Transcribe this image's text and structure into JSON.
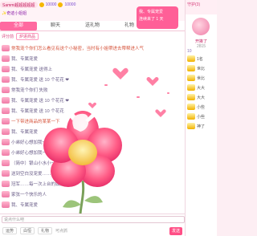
{
  "top": {
    "user_name": "Sammi超超超超超",
    "level": "Lv",
    "coins": "10000",
    "coins2": "10000",
    "note": "✨奇迹小姐姐"
  },
  "popup": {
    "line1": "我、专属宠爱",
    "line2": "连续来了 1 天"
  },
  "tabs": [
    "全部",
    "聊天",
    "送礼物",
    "礼物",
    "活动"
  ],
  "sub": {
    "label": "评分前",
    "chip": "炉进商品"
  },
  "messages": [
    {
      "name": "",
      "text": "常我宠个你们怎么看见有送个小秘密，当时有小姐帶进去帶帮进人气",
      "sys": true
    },
    {
      "name": "",
      "text": "我、专属宠爱",
      "sys": false
    },
    {
      "name": "",
      "text": "我、专属宠爱  送得上",
      "sys": false
    },
    {
      "name": "",
      "text": "我、专属宠爱  送 10 个花花 ❤",
      "sys": false
    },
    {
      "name": "",
      "text": "常我宠个你们 失败",
      "sys": false
    },
    {
      "name": "",
      "text": "我、专属宠爱  送 10 个花花 ❤",
      "sys": false
    },
    {
      "name": "",
      "text": "我、专属宠爱  送 10 个花花",
      "sys": false
    },
    {
      "name": "",
      "text": "一下带进商品的某某一下",
      "sys": true
    },
    {
      "name": "",
      "text": "我、专属宠爱",
      "sys": false
    },
    {
      "name": "",
      "text": "小弟好心想加我一下（侨为）",
      "sys": false
    },
    {
      "name": "",
      "text": "小弟好心想加我一下（红箱）",
      "sys": false
    },
    {
      "name": "",
      "text": "（简中）银山小水小一贺达",
      "sys": false
    },
    {
      "name": "",
      "text": "送到空白没宠爱……",
      "sys": false
    },
    {
      "name": "",
      "text": "冠军……每一次上台的鼓励…",
      "sys": false
    },
    {
      "name": "",
      "text": "家弦一个快乐的人",
      "sys": false
    },
    {
      "name": "",
      "text": "我、专属宠爱",
      "sys": false
    }
  ],
  "input": {
    "placeholder": "说点什么吧",
    "send": "发送"
  },
  "bottom": {
    "btn1": "运势",
    "btn2": "白恒",
    "btn3": "礼物",
    "label": "可点抓"
  },
  "right": {
    "header": "守护(3)",
    "name": "开挨了",
    "num": "2815",
    "rank_label": "10",
    "items": [
      {
        "text": "1名"
      },
      {
        "text": "世比"
      },
      {
        "text": "世比"
      },
      {
        "text": "大大"
      },
      {
        "text": "大大"
      },
      {
        "text": "小些"
      },
      {
        "text": "小些"
      },
      {
        "text": "神了"
      }
    ]
  },
  "colors": {
    "accent": "#ff5f97",
    "tab_active": "#ff6aa0",
    "system_text": "#d6543b"
  }
}
